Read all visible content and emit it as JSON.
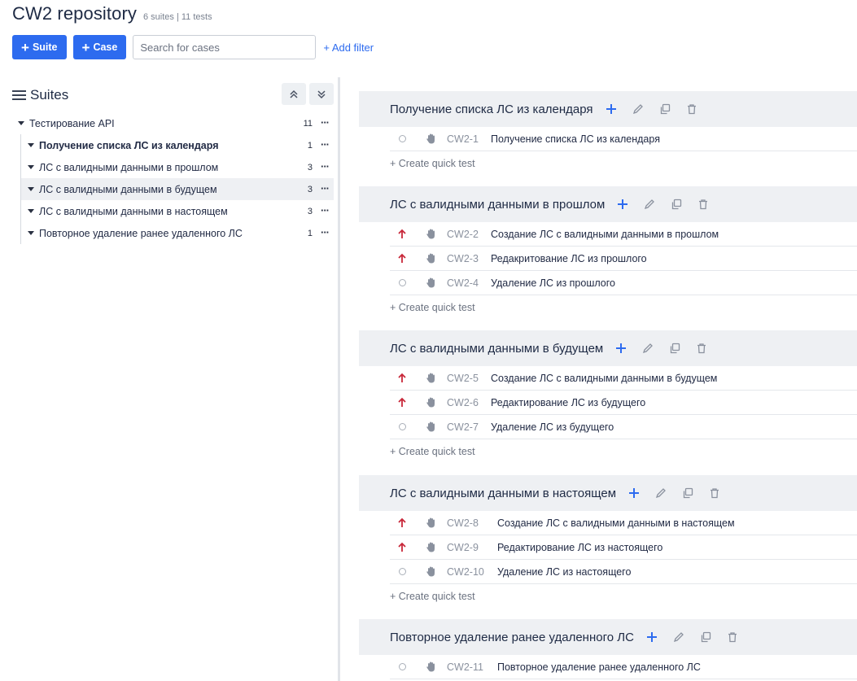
{
  "header": {
    "title": "CW2 repository",
    "subtitle": "6 suites | 11 tests"
  },
  "toolbar": {
    "suite_button": "Suite",
    "case_button": "Case",
    "search_placeholder": "Search for cases",
    "add_filter": "+ Add filter"
  },
  "sidebar": {
    "title": "Suites",
    "root": {
      "label": "Тестирование API",
      "count": "11"
    },
    "items": [
      {
        "label": "Получение списка ЛС из календаря",
        "count": "1",
        "bold": true,
        "selected": false
      },
      {
        "label": "ЛС с валидными данными в прошлом",
        "count": "3",
        "bold": false,
        "selected": false
      },
      {
        "label": "ЛС с валидными данными в будущем",
        "count": "3",
        "bold": false,
        "selected": true
      },
      {
        "label": "ЛС с валидными данными в настоящем",
        "count": "3",
        "bold": false,
        "selected": false
      },
      {
        "label": "Повторное удаление ранее удаленного ЛС",
        "count": "1",
        "bold": false,
        "selected": false
      }
    ]
  },
  "suites": [
    {
      "title": "Получение списка ЛС из календаря",
      "cases": [
        {
          "priority": "none",
          "id": "CW2-1",
          "title": "Получение списка ЛС из календаря"
        }
      ],
      "quick_label": "+ Create quick test"
    },
    {
      "title": "ЛС с валидными данными в прошлом",
      "cases": [
        {
          "priority": "high",
          "id": "CW2-2",
          "title": "Создание ЛС с валидными данными в прошлом"
        },
        {
          "priority": "high",
          "id": "CW2-3",
          "title": "Редакритование ЛС из прошлого"
        },
        {
          "priority": "none",
          "id": "CW2-4",
          "title": "Удаление ЛС из прошлого"
        }
      ],
      "quick_label": "+ Create quick test"
    },
    {
      "title": "ЛС с валидными данными в будущем",
      "cases": [
        {
          "priority": "high",
          "id": "CW2-5",
          "title": "Создание ЛС с валидными данными в будущем"
        },
        {
          "priority": "high",
          "id": "CW2-6",
          "title": "Редактирование ЛС из будущего"
        },
        {
          "priority": "none",
          "id": "CW2-7",
          "title": "Удаление ЛС из будущего"
        }
      ],
      "quick_label": "+ Create quick test"
    },
    {
      "title": "ЛС с валидными данными в настоящем",
      "cases": [
        {
          "priority": "high",
          "id": "CW2-8",
          "title": "Создание ЛС с валидными данными в настоящем"
        },
        {
          "priority": "high",
          "id": "CW2-9",
          "title": "Редактирование ЛС из настоящего"
        },
        {
          "priority": "none",
          "id": "CW2-10",
          "title": "Удаление ЛС из настоящего"
        }
      ],
      "quick_label": "+ Create quick test"
    },
    {
      "title": "Повторное удаление ранее удаленного ЛС",
      "cases": [
        {
          "priority": "none",
          "id": "CW2-11",
          "title": "Повторное удаление ранее удаленного ЛС"
        }
      ],
      "quick_label": ""
    }
  ],
  "colors": {
    "accent": "#2d6bef",
    "priority_high": "#c8283a",
    "panel": "#eef0f3"
  },
  "icons": [
    "plus-icon",
    "pencil-icon",
    "copy-icon",
    "trash-icon",
    "hand-icon",
    "arrow-up-icon",
    "circle-icon",
    "menu-icon",
    "chevron-double-up-icon",
    "chevron-double-down-icon",
    "more-icon"
  ]
}
